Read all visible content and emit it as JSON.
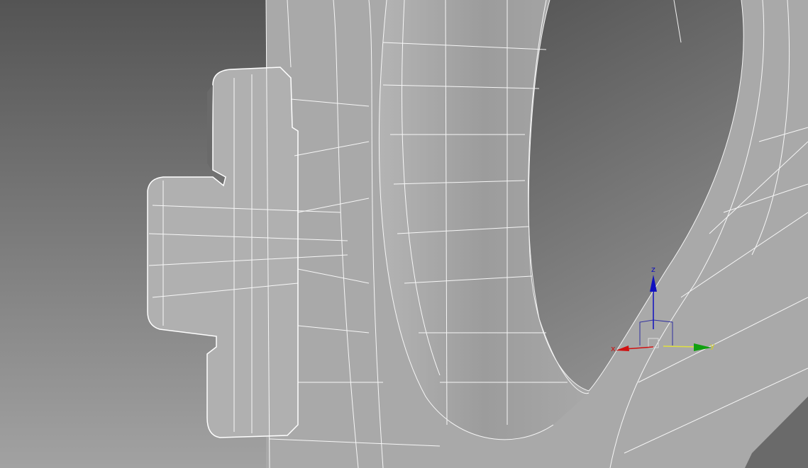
{
  "viewport": {
    "gizmo": {
      "x_label": "x",
      "y_label": "y",
      "z_label": "z",
      "colors": {
        "x": "#d01010",
        "y": "#10a010",
        "z": "#1010c0"
      }
    },
    "colors": {
      "wire": "#ffffff",
      "surface": "#a6a6a6",
      "background_top": "#555555",
      "background_bottom": "#a0a0a0"
    }
  }
}
